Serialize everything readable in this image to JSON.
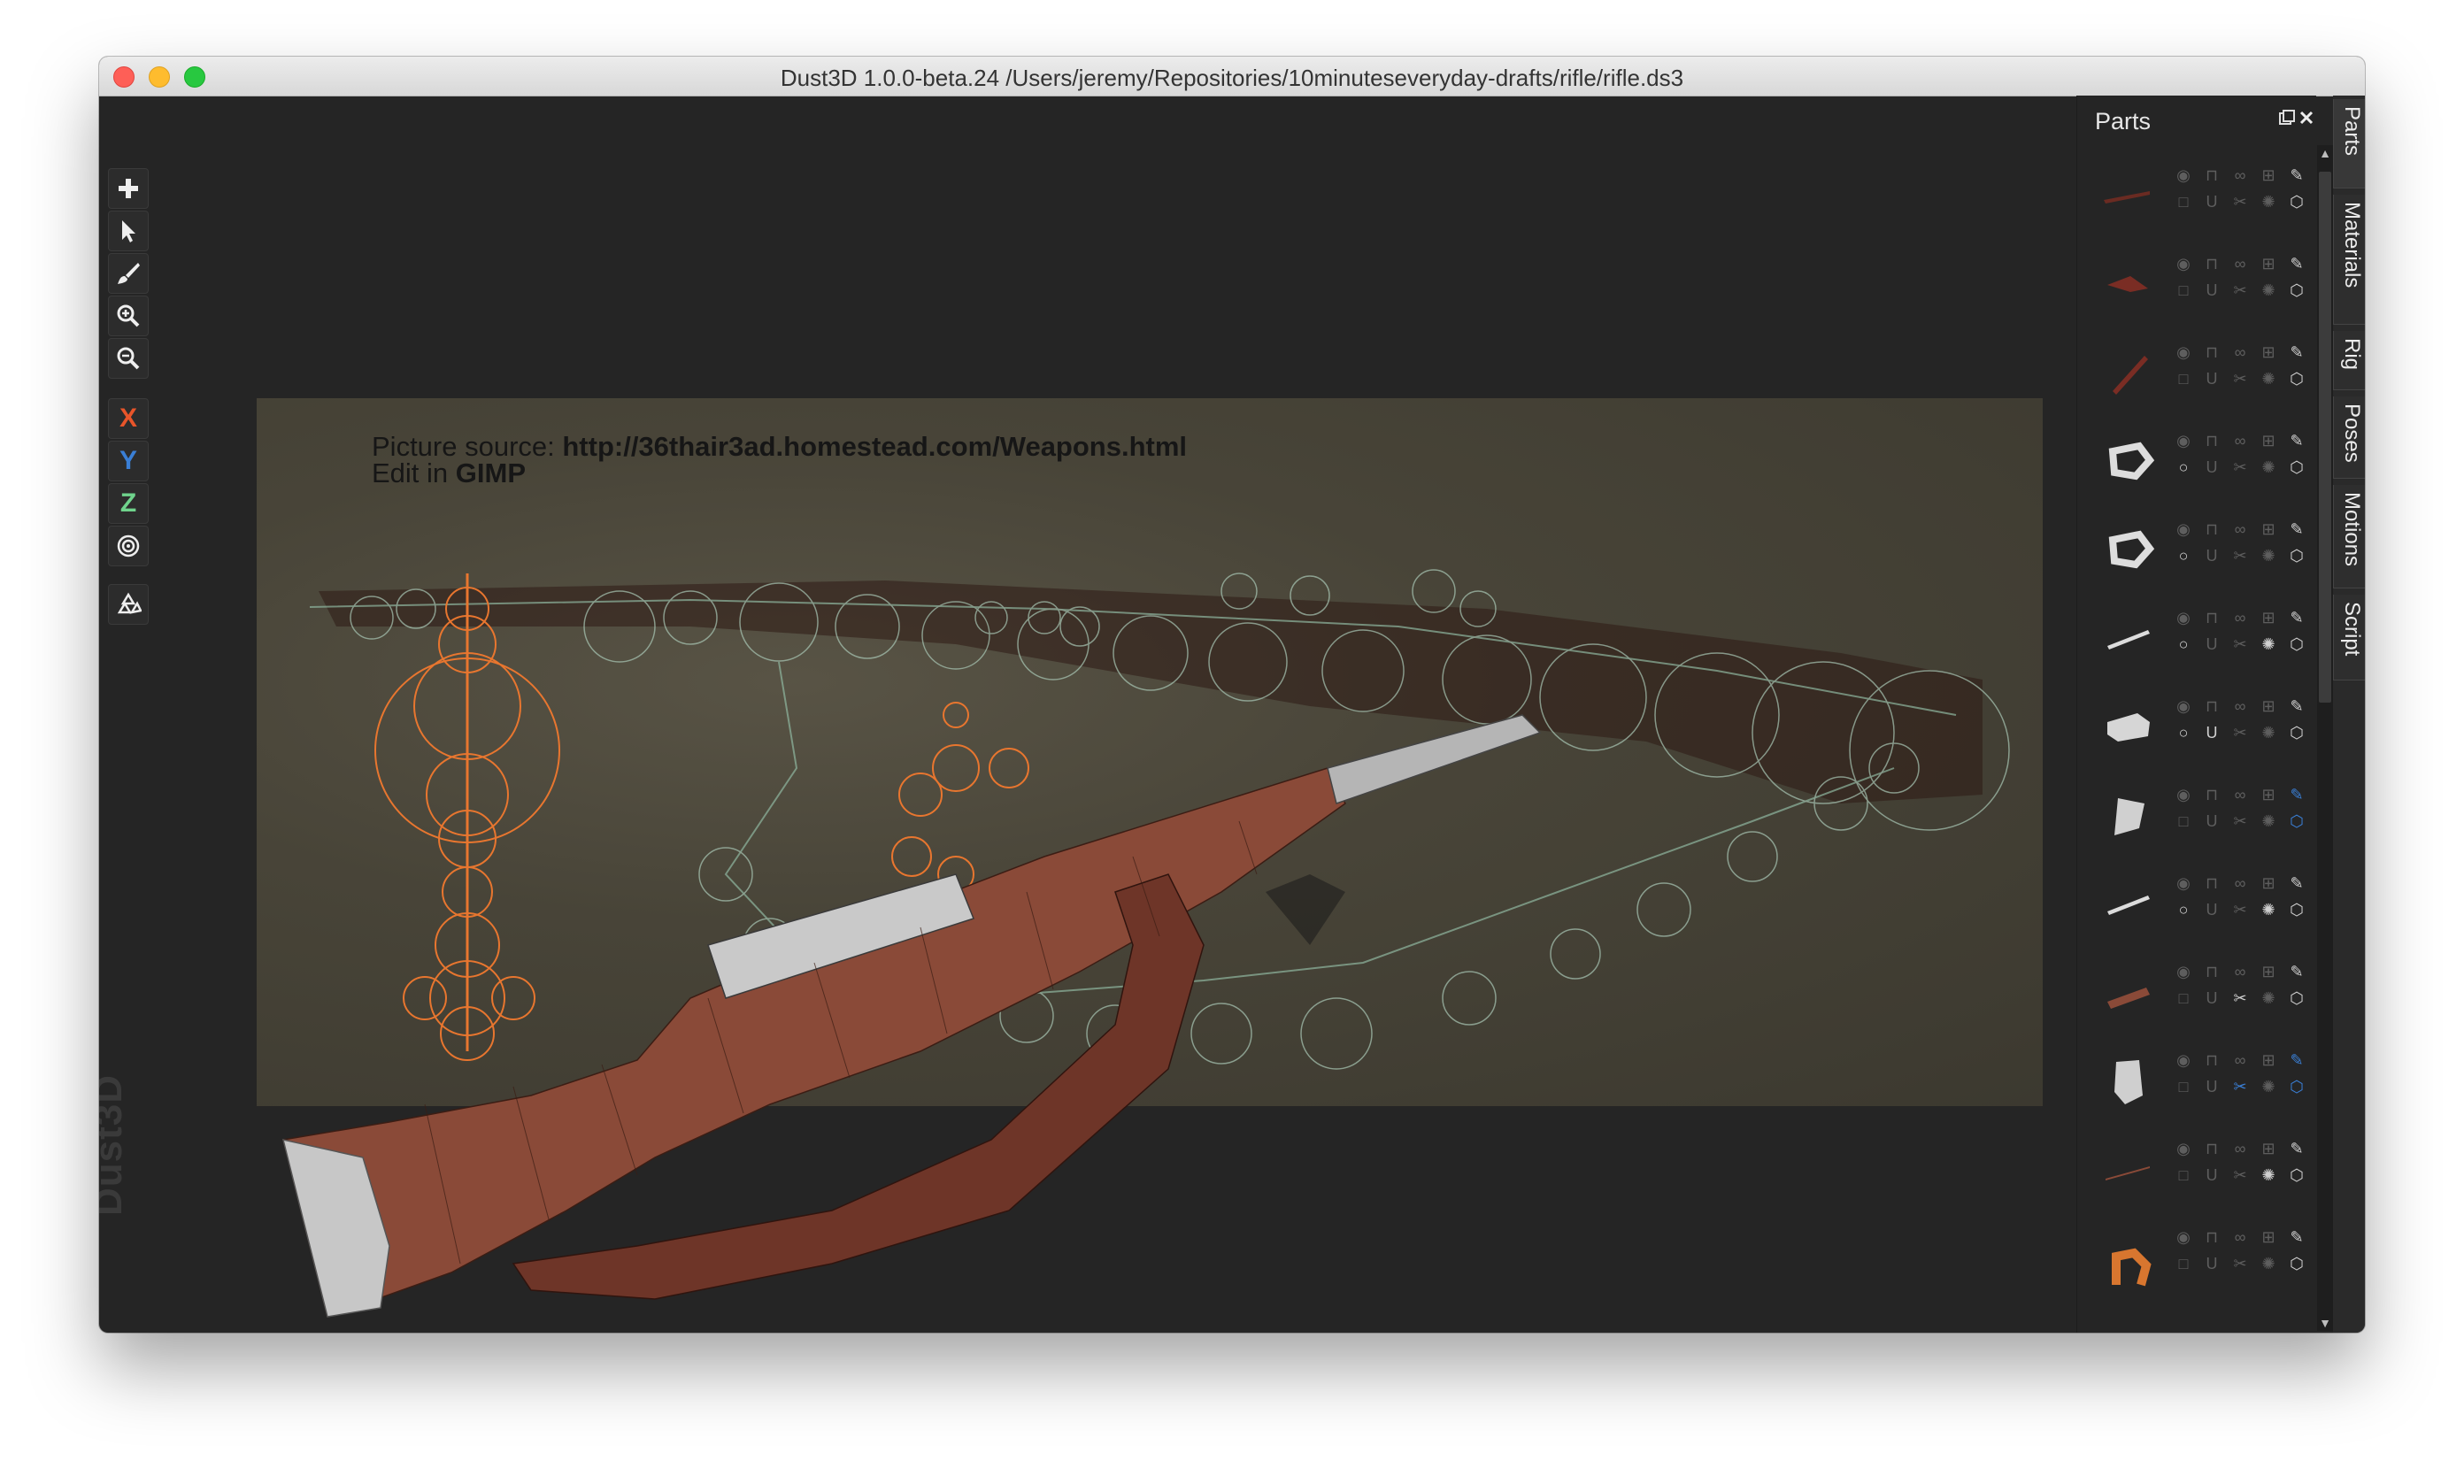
{
  "window": {
    "title": "Dust3D 1.0.0-beta.24 /Users/jeremy/Repositories/10minuteseveryday-drafts/rifle/rifle.ds3"
  },
  "toolbar": {
    "add_icon": "plus-icon",
    "select_icon": "arrow-pointer-icon",
    "paint_icon": "brush-icon",
    "zoom_in_icon": "zoom-in-icon",
    "zoom_out_icon": "zoom-out-icon",
    "x_label": "X",
    "y_label": "Y",
    "z_label": "Z",
    "radius_icon": "target-icon",
    "regenerate_icon": "recycle-icon",
    "x_color": "#e8552a",
    "y_color": "#3a7fd6",
    "z_color": "#6fd38c"
  },
  "viewport": {
    "source_prefix": "Picture source: ",
    "source_url": "http://36thair3ad.homestead.com/Weapons.html",
    "edit_prefix": "Edit in ",
    "edit_app": "GIMP",
    "watermark": "Dust3D"
  },
  "parts_panel": {
    "title": "Parts",
    "float_icon": "float-window-icon",
    "close_icon": "close-icon",
    "parts": [
      {
        "thumb": "rod-dark-red",
        "lock": false,
        "subdiv": false,
        "chamfer": false,
        "roundend": false,
        "xmirror": false,
        "color_active": false
      },
      {
        "thumb": "wedge-red",
        "lock": false,
        "subdiv": false,
        "chamfer": false,
        "roundend": false,
        "xmirror": false,
        "color_active": false
      },
      {
        "thumb": "rod-diagonal-red",
        "lock": false,
        "subdiv": false,
        "chamfer": false,
        "roundend": false,
        "xmirror": false,
        "color_active": false
      },
      {
        "thumb": "ring-white",
        "lock": false,
        "subdiv": true,
        "chamfer": false,
        "roundend": false,
        "xmirror": false,
        "color_active": false
      },
      {
        "thumb": "ring-white",
        "lock": false,
        "subdiv": true,
        "chamfer": false,
        "roundend": false,
        "xmirror": false,
        "color_active": false
      },
      {
        "thumb": "rod-white",
        "lock": false,
        "subdiv": true,
        "chamfer": false,
        "roundend": true,
        "xmirror": false,
        "color_active": false
      },
      {
        "thumb": "block-white",
        "lock": false,
        "subdiv": true,
        "chamfer": false,
        "roundend": false,
        "xmirror": true,
        "color_active": false
      },
      {
        "thumb": "plate-white",
        "lock": false,
        "subdiv": false,
        "chamfer": false,
        "roundend": false,
        "xmirror": false,
        "color_active": true
      },
      {
        "thumb": "rod-white",
        "lock": false,
        "subdiv": true,
        "chamfer": false,
        "roundend": true,
        "xmirror": false,
        "color_active": false
      },
      {
        "thumb": "plank-brown",
        "lock": false,
        "subdiv": false,
        "chamfer": true,
        "roundend": false,
        "xmirror": false,
        "color_active": false
      },
      {
        "thumb": "block-white-tall",
        "lock": false,
        "subdiv": false,
        "chamfer": true,
        "roundend": false,
        "xmirror": false,
        "color_active": true
      },
      {
        "thumb": "rod-thin-brown",
        "lock": false,
        "subdiv": false,
        "chamfer": false,
        "roundend": true,
        "xmirror": false,
        "color_active": false
      },
      {
        "thumb": "hook-orange",
        "lock": false,
        "subdiv": false,
        "chamfer": false,
        "roundend": false,
        "xmirror": false,
        "color_active": false
      }
    ]
  },
  "side_tabs": [
    "Parts",
    "Materials",
    "Rig",
    "Poses",
    "Motions",
    "Script"
  ]
}
